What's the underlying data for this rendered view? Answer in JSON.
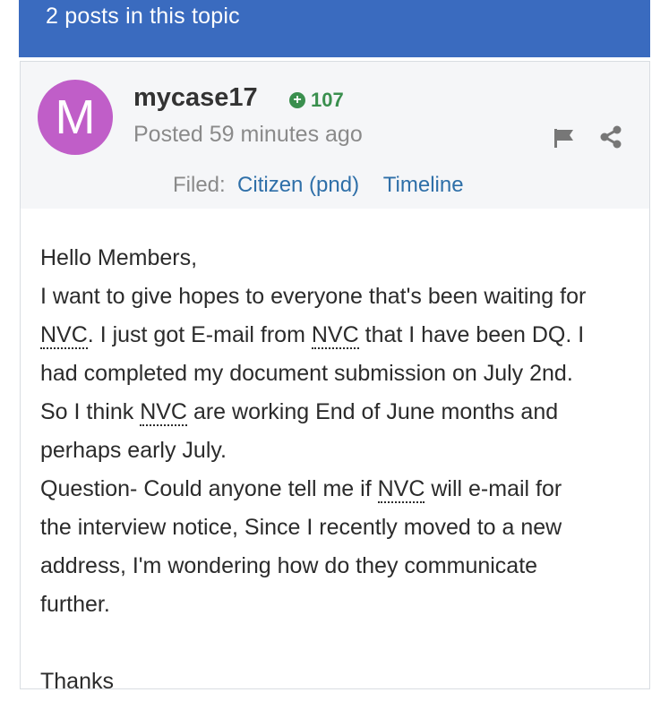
{
  "topic_bar": {
    "text": "2 posts in this topic"
  },
  "post": {
    "avatar_letter": "M",
    "author": "mycase17",
    "reputation": "107",
    "posted": "Posted 59 minutes ago",
    "filed_label": "Filed:",
    "filed_links": [
      "Citizen (pnd)",
      "Timeline"
    ],
    "icons": [
      "flag-icon",
      "share-icon",
      "plus-icon"
    ],
    "colors": {
      "avatar": "#c05ec8",
      "topic_bar": "#3a6bbf",
      "reputation": "#3a8f4e",
      "link": "#2e6fa8"
    },
    "body": {
      "greeting": "Hello Members,",
      "l1": "I want to give hopes to everyone that's been waiting for",
      "abbr": "NVC",
      "l2a": ". I just got E-mail from",
      "l2b": "that I have been DQ. I",
      "l3": "had completed my document submission on July 2nd.",
      "l4a": "So I think",
      "l4b": "are working End of June months and",
      "l5": "perhaps early July.",
      "l6a": "Question- Could anyone tell me if",
      "l6b": "will e-mail for",
      "l7": "the interview notice, Since I recently moved to a new",
      "l8": "address, I'm wondering how do they communicate",
      "l9": "further.",
      "l10": "Thanks"
    }
  }
}
